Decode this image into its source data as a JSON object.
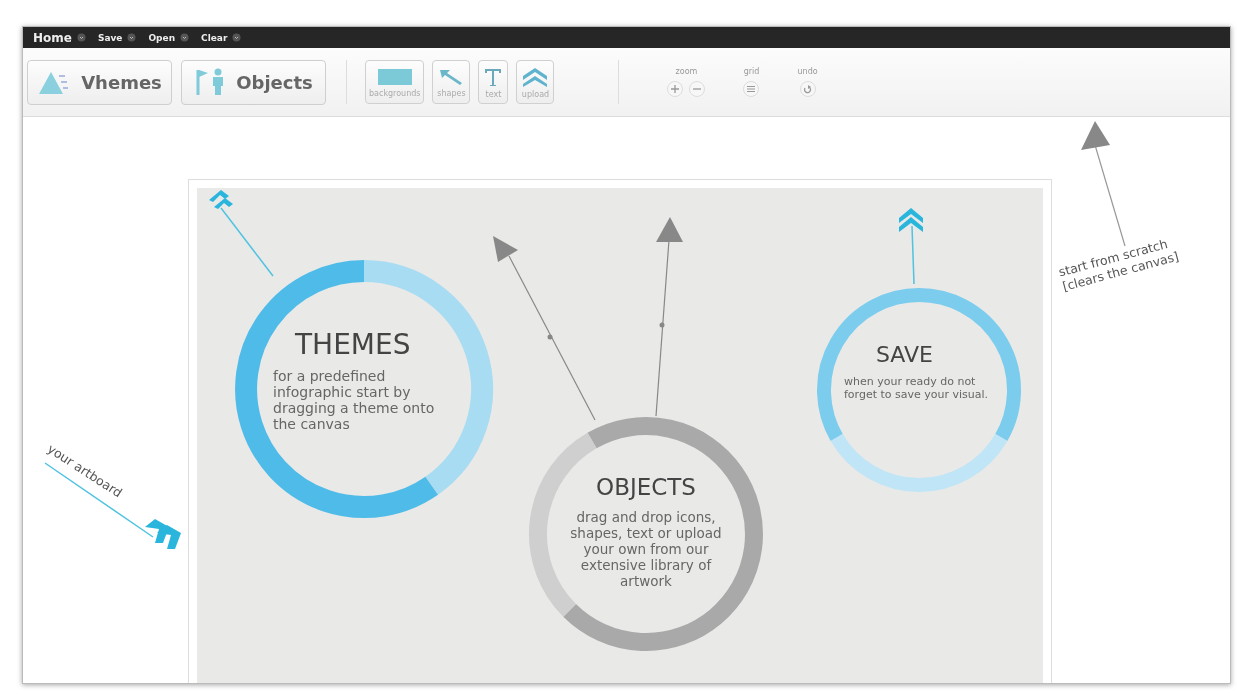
{
  "menu": [
    {
      "label": "Home"
    },
    {
      "label": "Save"
    },
    {
      "label": "Open"
    },
    {
      "label": "Clear"
    }
  ],
  "main_buttons": [
    {
      "label": "Vhemes",
      "kind": "themes"
    },
    {
      "label": "Objects",
      "kind": "objects"
    }
  ],
  "tools": [
    {
      "label": "backgrounds",
      "kind": "backgrounds"
    },
    {
      "label": "shapes",
      "kind": "shapes"
    },
    {
      "label": "text",
      "kind": "text"
    },
    {
      "label": "upload",
      "kind": "upload"
    }
  ],
  "controls": [
    {
      "label": "zoom",
      "kind": "zoom"
    },
    {
      "label": "grid",
      "kind": "grid"
    },
    {
      "label": "undo",
      "kind": "undo"
    }
  ],
  "cards": [
    {
      "kind": "themes",
      "title": "THEMES",
      "text": "for a predefined infographic start by dragging a theme onto the canvas"
    },
    {
      "kind": "objects",
      "title": "OBJECTS",
      "text": "drag and drop icons, shapes, text or upload your own from our extensive library of artwork"
    },
    {
      "kind": "save",
      "title": "SAVE",
      "text": "when your ready do not forget to save your visual."
    }
  ],
  "annotations": [
    {
      "kind": "artboard",
      "text": "your artboard"
    },
    {
      "kind": "clear",
      "text": "start from scratch [clears the canvas]"
    }
  ]
}
